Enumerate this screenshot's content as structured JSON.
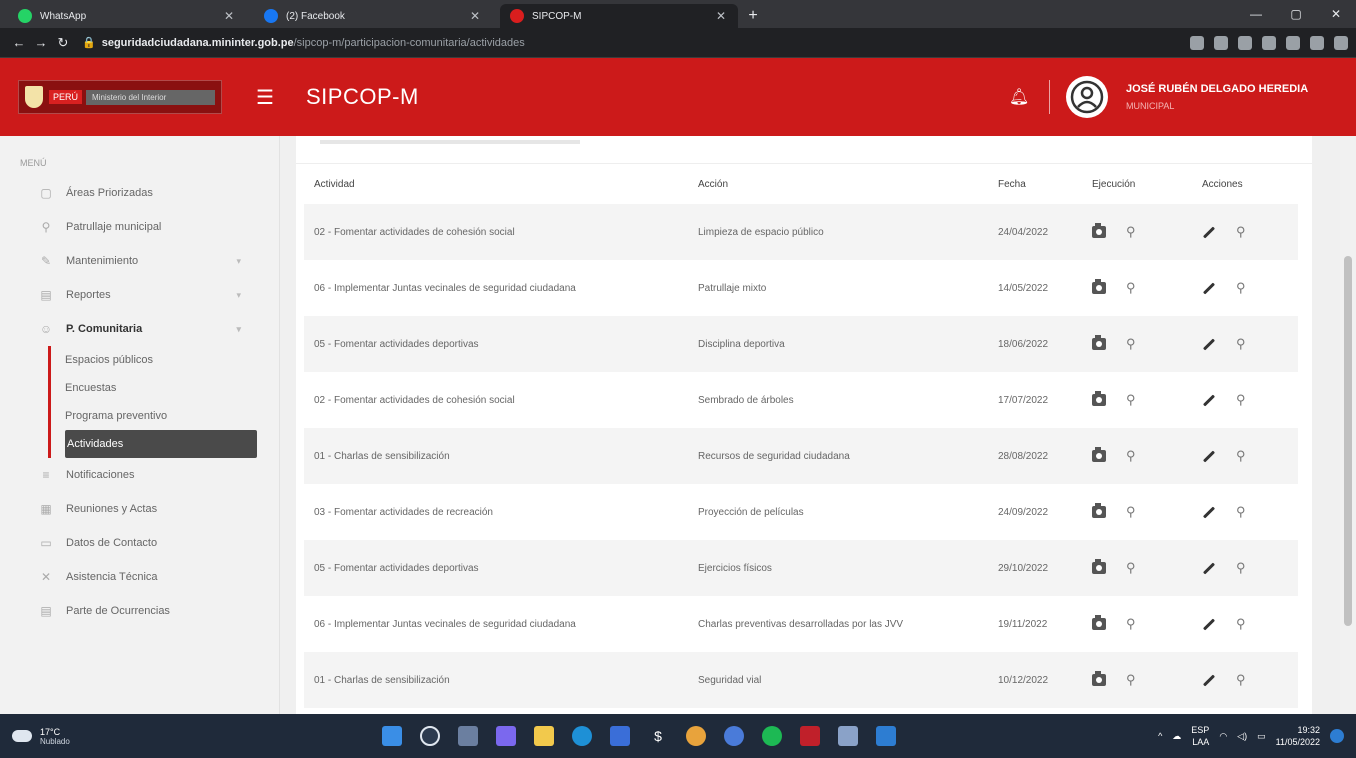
{
  "browser": {
    "tabs": [
      {
        "label": "WhatsApp",
        "color": "#25d366",
        "active": false
      },
      {
        "label": "(2) Facebook",
        "color": "#1877f2",
        "active": false
      },
      {
        "label": "SIPCOP-M",
        "color": "#d91e1e",
        "active": true
      }
    ],
    "url_host": "seguridadciudadana.mininter.gob.pe",
    "url_path": "/sipcop-m/participacion-comunitaria/actividades"
  },
  "header": {
    "logo_country": "PERÚ",
    "logo_ministry": "Ministerio del Interior",
    "app_title": "SIPCOP-M",
    "user_name": "JOSÉ RUBÉN DELGADO HEREDIA",
    "user_role": "MUNICIPAL"
  },
  "sidebar": {
    "menu_label": "MENÚ",
    "items": [
      {
        "label": "Áreas Priorizadas",
        "icon": "map-icon",
        "glyph": "▢"
      },
      {
        "label": "Patrullaje municipal",
        "icon": "pin-icon",
        "glyph": "⚲"
      },
      {
        "label": "Mantenimiento",
        "icon": "wrench-icon",
        "glyph": "✎"
      },
      {
        "label": "Reportes",
        "icon": "report-icon",
        "glyph": "▤"
      },
      {
        "label": "P. Comunitaria",
        "icon": "community-icon",
        "glyph": "☺"
      }
    ],
    "subitems": [
      "Espacios públicos",
      "Encuestas",
      "Programa preventivo",
      "Actividades"
    ],
    "items_after": [
      {
        "label": "Notificaciones",
        "icon": "bell-icon",
        "glyph": "≡"
      },
      {
        "label": "Reuniones y Actas",
        "icon": "meeting-icon",
        "glyph": "▦"
      },
      {
        "label": "Datos de Contacto",
        "icon": "contact-icon",
        "glyph": "▭"
      },
      {
        "label": "Asistencia Técnica",
        "icon": "support-icon",
        "glyph": "✕"
      },
      {
        "label": "Parte de Ocurrencias",
        "icon": "incident-icon",
        "glyph": "▤"
      }
    ]
  },
  "table": {
    "columns": [
      "Actividad",
      "Acción",
      "Fecha",
      "Ejecución",
      "Acciones"
    ],
    "rows": [
      [
        "02 - Fomentar actividades de cohesión social",
        "Limpieza de espacio público",
        "24/04/2022"
      ],
      [
        "06 - Implementar Juntas vecinales de seguridad ciudadana",
        "Patrullaje mixto",
        "14/05/2022"
      ],
      [
        "05 - Fomentar actividades deportivas",
        "Disciplina deportiva",
        "18/06/2022"
      ],
      [
        "02 - Fomentar actividades de cohesión social",
        "Sembrado de árboles",
        "17/07/2022"
      ],
      [
        "01 - Charlas de sensibilización",
        "Recursos de seguridad ciudadana",
        "28/08/2022"
      ],
      [
        "03 - Fomentar actividades de recreación",
        "Proyección de películas",
        "24/09/2022"
      ],
      [
        "05 - Fomentar actividades deportivas",
        "Ejercicios físicos",
        "29/10/2022"
      ],
      [
        "06 - Implementar Juntas vecinales de seguridad ciudadana",
        "Charlas preventivas desarrolladas por las JVV",
        "19/11/2022"
      ],
      [
        "01 - Charlas de sensibilización",
        "Seguridad vial",
        "10/12/2022"
      ]
    ]
  },
  "taskbar": {
    "temp": "17°C",
    "weather": "Nublado",
    "lang": "ESP",
    "lang2": "LAA",
    "time": "19:32",
    "date": "11/05/2022"
  },
  "colors": {
    "brand_red": "#cc1a1a",
    "active_item": "#4a4a4a"
  }
}
